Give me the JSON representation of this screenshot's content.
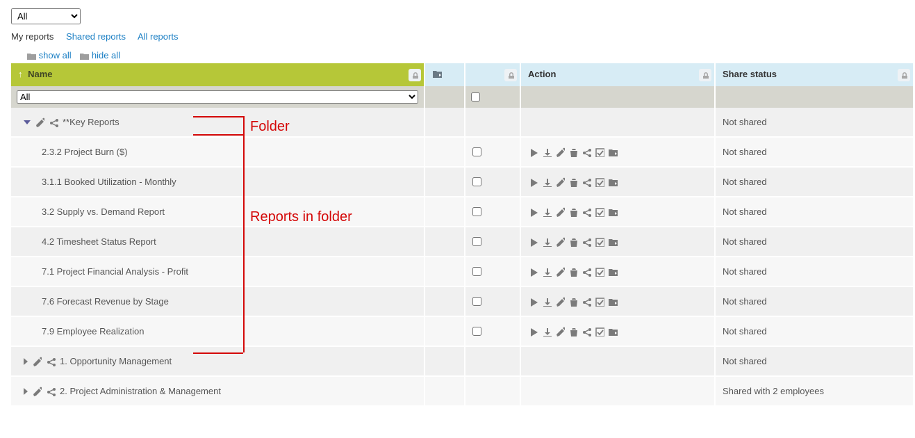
{
  "topFilter": {
    "value": "All"
  },
  "tabs": {
    "my": "My reports",
    "shared": "Shared reports",
    "all": "All reports"
  },
  "treeControls": {
    "showAll": "show all",
    "hideAll": "hide all"
  },
  "columns": {
    "name": "Name",
    "action": "Action",
    "share": "Share status"
  },
  "filterRow": {
    "nameFilter": "All"
  },
  "folders": [
    {
      "expanded": true,
      "name": "**Key Reports",
      "share": "Not shared"
    },
    {
      "expanded": false,
      "name": "1. Opportunity Management",
      "share": "Not shared"
    },
    {
      "expanded": false,
      "name": "2. Project Administration & Management",
      "share": "Shared with 2 employees"
    }
  ],
  "reports": [
    {
      "name": "2.3.2 Project Burn ($)",
      "share": "Not shared"
    },
    {
      "name": "3.1.1 Booked Utilization - Monthly",
      "share": "Not shared"
    },
    {
      "name": "3.2 Supply vs. Demand Report",
      "share": "Not shared"
    },
    {
      "name": "4.2 Timesheet Status Report",
      "share": "Not shared"
    },
    {
      "name": "7.1 Project Financial Analysis - Profit",
      "share": "Not shared"
    },
    {
      "name": "7.6 Forecast Revenue by Stage",
      "share": "Not shared"
    },
    {
      "name": "7.9 Employee Realization",
      "share": "Not shared"
    }
  ],
  "annotations": {
    "folder": "Folder",
    "reportsInFolder": "Reports in folder"
  }
}
